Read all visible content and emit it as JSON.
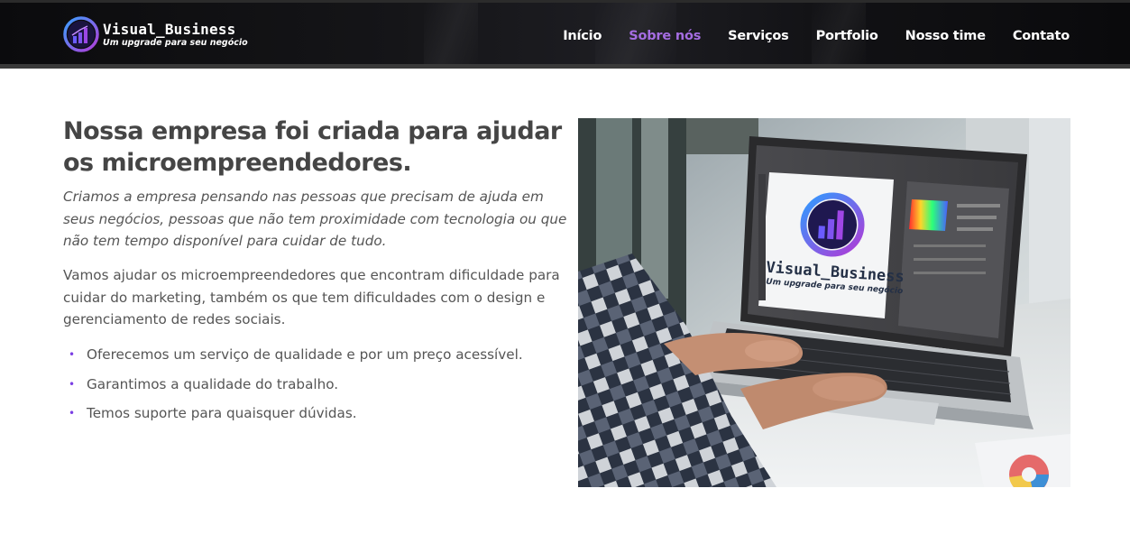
{
  "brand": {
    "name": "Visual_Business",
    "tagline": "Um upgrade para seu negócio",
    "accent_color": "#a56de2",
    "bullet_color": "#7b3fe4"
  },
  "nav": {
    "items": [
      {
        "label": "Início",
        "active": false
      },
      {
        "label": "Sobre nós",
        "active": true
      },
      {
        "label": "Serviços",
        "active": false
      },
      {
        "label": "Portfolio",
        "active": false
      },
      {
        "label": "Nosso time",
        "active": false
      },
      {
        "label": "Contato",
        "active": false
      }
    ]
  },
  "about": {
    "title": "Nossa empresa foi criada para ajudar os microempreendedores.",
    "intro": "Criamos a empresa pensando nas pessoas que precisam de ajuda em seus negócios, pessoas que não tem proximidade com tecnologia ou que não tem tempo disponível para cuidar de tudo.",
    "body": "Vamos ajudar os microempreendedores que encontram dificuldade para cuidar do marketing, também os que tem dificuldades com o design e gerenciamento de redes sociais.",
    "features": [
      "Oferecemos um serviço de qualidade e por um preço acessível.",
      "Garantimos a qualidade do trabalho.",
      "Temos suporte para quaisquer dúvidas."
    ]
  },
  "hero_image": {
    "logo_name": "Visual_Business",
    "logo_tagline": "Um upgrade para seu negócio"
  }
}
